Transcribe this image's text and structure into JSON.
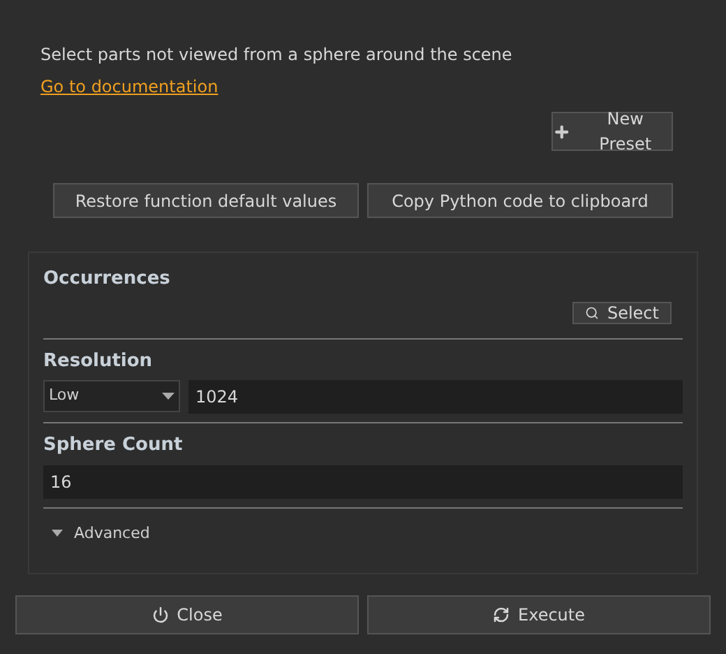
{
  "description": "Select parts not viewed from a sphere around the scene",
  "doc_link": "Go to documentation",
  "new_preset_button": "New Preset",
  "tool_buttons": [
    "Restore function default values",
    "Copy Python code to clipboard"
  ],
  "occurrences": {
    "label": "Occurrences",
    "button": "Select"
  },
  "resolution": {
    "label": "Resolution",
    "dropdown": "Low",
    "value": "1024"
  },
  "sphere_count": {
    "label": "Sphere Count",
    "value": "16"
  },
  "advanced": {
    "label": "Advanced"
  },
  "footer_buttons": [
    {
      "kind": "close",
      "label": "Close"
    },
    {
      "kind": "execute",
      "label": "Execute"
    }
  ]
}
